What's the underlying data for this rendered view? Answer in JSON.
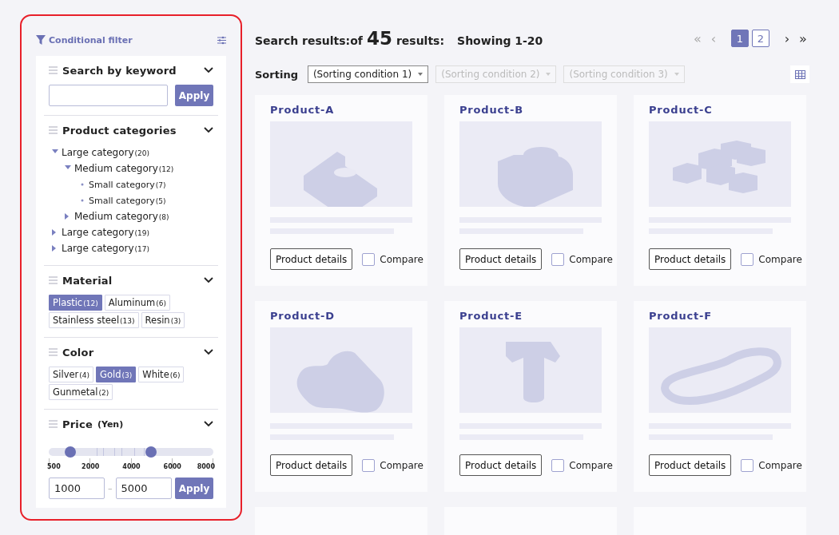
{
  "filter": {
    "title": "Conditional filter",
    "keyword": {
      "title": "Search by keyword",
      "expanded": true,
      "button": "Apply"
    },
    "categories": {
      "title": "Product categories",
      "expanded": true,
      "items": [
        {
          "label": "Large category",
          "count": "(20)",
          "expanded": true,
          "children": [
            {
              "label": "Medium category",
              "count": "(12)",
              "expanded": true,
              "children": [
                {
                  "label": "Small category",
                  "count": "(7)"
                },
                {
                  "label": "Small category",
                  "count": "(5)"
                }
              ]
            },
            {
              "label": "Medium category",
              "count": "(8)",
              "expanded": false
            }
          ]
        },
        {
          "label": "Large category",
          "count": "(19)",
          "expanded": false
        },
        {
          "label": "Large category",
          "count": "(17)",
          "expanded": false
        }
      ]
    },
    "material": {
      "title": "Material",
      "expanded": true,
      "chips": [
        {
          "label": "Plastic",
          "count": "(12)",
          "selected": true
        },
        {
          "label": "Aluminum",
          "count": "(6)",
          "selected": false
        },
        {
          "label": "Stainless steel",
          "count": "(13)",
          "selected": false
        },
        {
          "label": "Resin",
          "count": "(3)",
          "selected": false
        }
      ]
    },
    "color": {
      "title": "Color",
      "expanded": true,
      "chips": [
        {
          "label": "Silver",
          "count": "(4)",
          "selected": false
        },
        {
          "label": "Gold",
          "count": "(3)",
          "selected": true
        },
        {
          "label": "White",
          "count": "(6)",
          "selected": false
        },
        {
          "label": "Gunmetal",
          "count": "(2)",
          "selected": false
        }
      ]
    },
    "price": {
      "title": "Price",
      "unit": "(Yen)",
      "expanded": true,
      "low": {
        "level": 0.13
      },
      "high": {
        "level": 0.62
      },
      "ticks": [
        "500",
        "2000",
        "4000",
        "6000",
        "8000"
      ],
      "min": "1000",
      "separator": "–",
      "max": "5000",
      "button": "Apply"
    }
  },
  "results": {
    "label": "Search results:of",
    "count": "45",
    "suffix": "results:",
    "showing": "Showing 1-20"
  },
  "pagination": {
    "first": "«",
    "prev": "‹",
    "pages": [
      {
        "label": "1",
        "selected": true
      },
      {
        "label": "2",
        "selected": false
      }
    ],
    "next": "›",
    "last": "»"
  },
  "sorting": {
    "label": "Sorting",
    "selects": [
      {
        "value": "(Sorting condition 1)",
        "disabled": false
      },
      {
        "value": "(Sorting condition 2)",
        "disabled": true
      },
      {
        "value": "(Sorting condition 3)",
        "disabled": true
      }
    ]
  },
  "products": [
    {
      "kind": "card",
      "name": "Product-A",
      "button": "Product details",
      "compare": "Compare",
      "checked": false
    },
    {
      "kind": "card",
      "name": "Product-B",
      "button": "Product details",
      "compare": "Compare",
      "checked": false
    },
    {
      "kind": "card",
      "name": "Product-C",
      "button": "Product details",
      "compare": "Compare",
      "checked": false
    },
    {
      "kind": "card",
      "name": "Product-D",
      "button": "Product details",
      "compare": "Compare",
      "checked": false
    },
    {
      "kind": "card",
      "name": "Product-E",
      "button": "Product details",
      "compare": "Compare",
      "checked": false
    },
    {
      "kind": "card",
      "name": "Product-F",
      "button": "Product details",
      "compare": "Compare",
      "checked": false
    },
    {
      "kind": "cut-off"
    },
    {
      "kind": "cut-off"
    },
    {
      "kind": "cut-off"
    }
  ]
}
